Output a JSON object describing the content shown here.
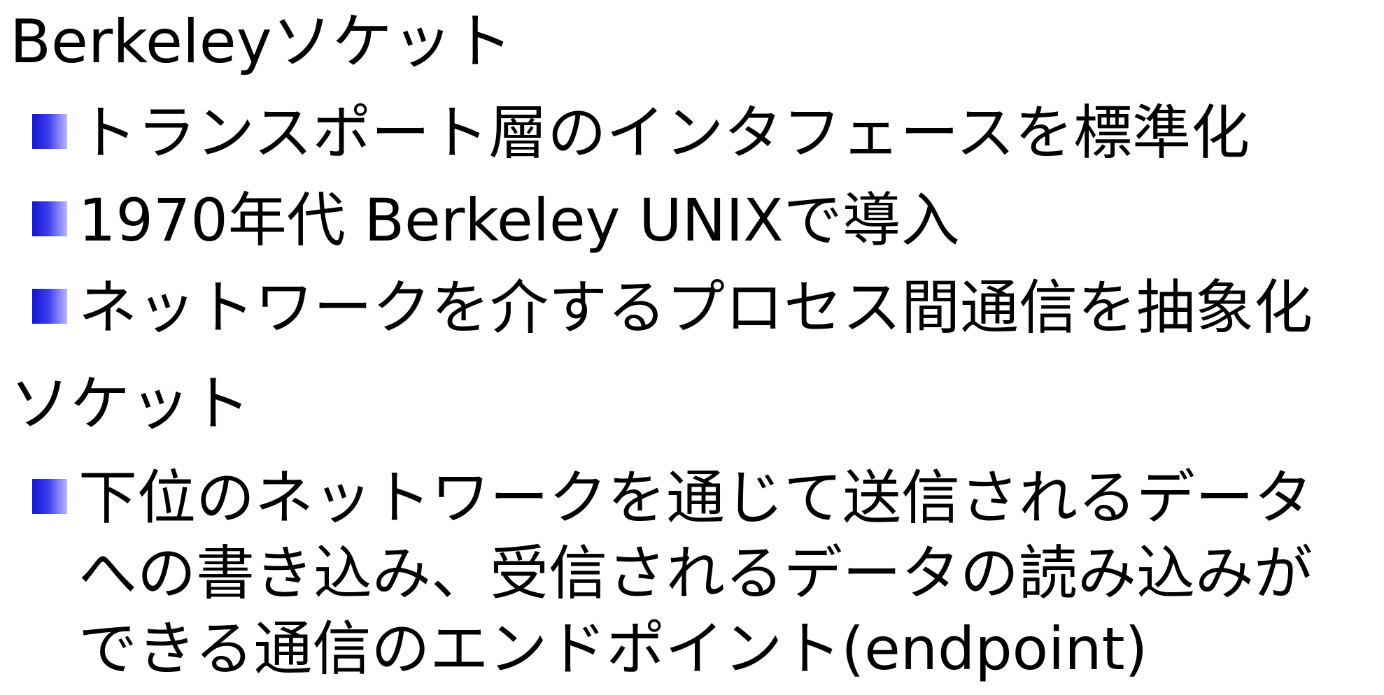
{
  "slide": {
    "heading_1": "Berkeleyソケット",
    "bullets_1": [
      "トランスポート層のインタフェースを標準化",
      "1970年代 Berkeley UNIXで導入",
      "ネットワークを介するプロセス間通信を抽象化"
    ],
    "heading_2": "ソケット",
    "bullets_2": [
      {
        "lines": [
          "下位のネットワークを通じて送信されるデータ",
          "への書き込み、受信されるデータの読み込みが",
          "できる通信のエンドポイント(endpoint)"
        ]
      }
    ]
  },
  "colors": {
    "bullet_square": "#1414c8",
    "text": "#000000",
    "background": "#ffffff"
  },
  "icons": {
    "bullet": "square-bullet-icon"
  }
}
